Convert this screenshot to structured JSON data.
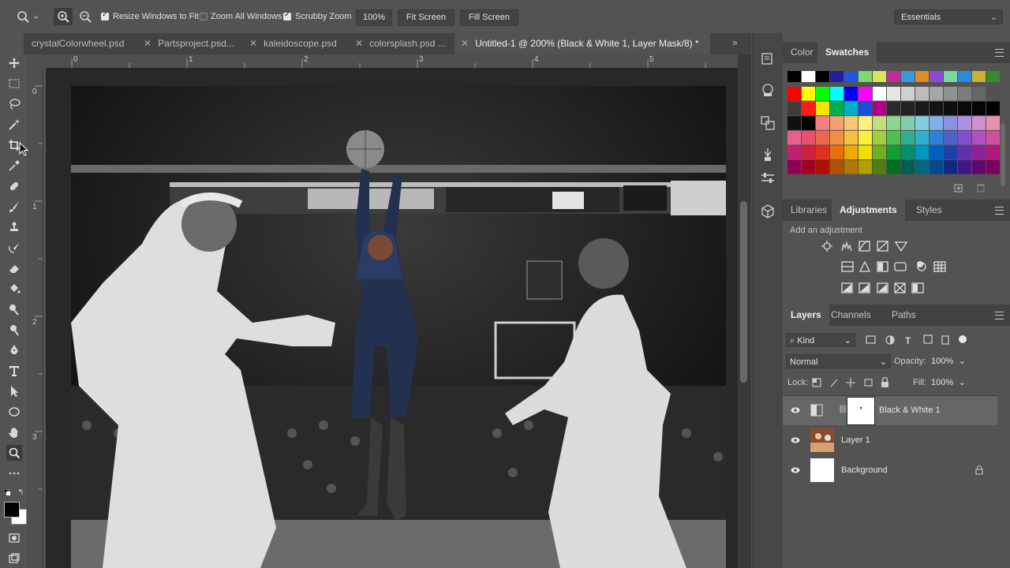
{
  "options_bar": {
    "resize_windows_label": "Resize Windows to Fit",
    "zoom_all_label": "Zoom All Windows",
    "scrubby_zoom_label": "Scrubby Zoom",
    "zoom_value": "100%",
    "fit_screen_label": "Fit Screen",
    "fill_screen_label": "Fill Screen",
    "workspace": "Essentials"
  },
  "tabs": [
    {
      "label": "crystalColorwheel.psd"
    },
    {
      "label": "Partsproject.psd..."
    },
    {
      "label": "kaleidoscope.psd"
    },
    {
      "label": "colorsplash.psd ..."
    },
    {
      "label": "Untitled-1 @ 200% (Black & White 1, Layer Mask/8) *",
      "active": true
    }
  ],
  "ruler": {
    "h_ticks": [
      "0",
      "1",
      "2",
      "3",
      "4",
      "5"
    ],
    "v_ticks": [
      "0",
      "1",
      "2",
      "3"
    ]
  },
  "color_panel": {
    "tabs": [
      "Color",
      "Swatches"
    ],
    "active": "Swatches"
  },
  "adjustments_panel": {
    "tabs": [
      "Libraries",
      "Adjustments",
      "Styles"
    ],
    "active": "Adjustments",
    "hint": "Add an adjustment"
  },
  "layers_panel": {
    "tabs": [
      "Layers",
      "Channels",
      "Paths"
    ],
    "active": "Layers",
    "filter": "Kind",
    "blend_mode": "Normal",
    "opacity_label": "Opacity:",
    "opacity": "100%",
    "lock_label": "Lock:",
    "fill_label": "Fill:",
    "fill": "100%",
    "layers": [
      {
        "name": "Black & White 1",
        "selected": true
      },
      {
        "name": "Layer 1"
      },
      {
        "name": "Background",
        "locked": true
      }
    ]
  }
}
